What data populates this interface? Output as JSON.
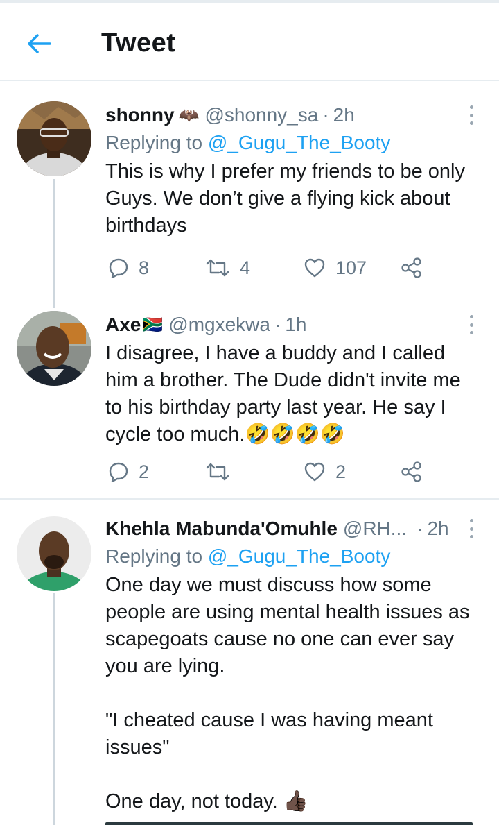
{
  "header": {
    "title": "Tweet",
    "back_icon": "arrow-left-icon",
    "accent": "#1da1f2"
  },
  "tweets": [
    {
      "name": "shonny",
      "name_emoji": "🦇",
      "handle": "@shonny_sa",
      "separator": "·",
      "time": "2h",
      "replying_prefix": "Replying to",
      "replying_to": "@_Gugu_The_Booty",
      "text": "This is why I prefer my friends to be only Guys. We don’t give a flying kick about birthdays",
      "replies": "8",
      "retweets": "4",
      "likes": "107"
    },
    {
      "name": "Axe",
      "name_emoji": "🇿🇦",
      "handle": "@mgxekwa",
      "separator": "·",
      "time": "1h",
      "text": "I disagree, I have a buddy and I called him a brother. The Dude didn't invite me to his birthday party last year. He say I cycle too much.🤣🤣🤣🤣",
      "replies": "2",
      "retweets": "",
      "likes": "2"
    },
    {
      "name": "Khehla Mabunda'Omuhle",
      "handle": "@RH...",
      "separator": "·",
      "time": "2h",
      "replying_prefix": "Replying to",
      "replying_to": "@_Gugu_The_Booty",
      "text": "One day we must discuss how some people are using mental health issues as scapegoats cause no one can ever say you are lying.\n\n\"I cheated cause I was having meant issues\"\n\nOne day, not today. 👍🏿"
    }
  ],
  "icons": {
    "reply": "reply-icon",
    "retweet": "retweet-icon",
    "like": "heart-icon",
    "share": "share-icon",
    "more": "more-vertical-icon"
  },
  "colors": {
    "text": "#14171a",
    "muted": "#657786",
    "link": "#1da1f2",
    "divider": "#e6ecf0"
  }
}
